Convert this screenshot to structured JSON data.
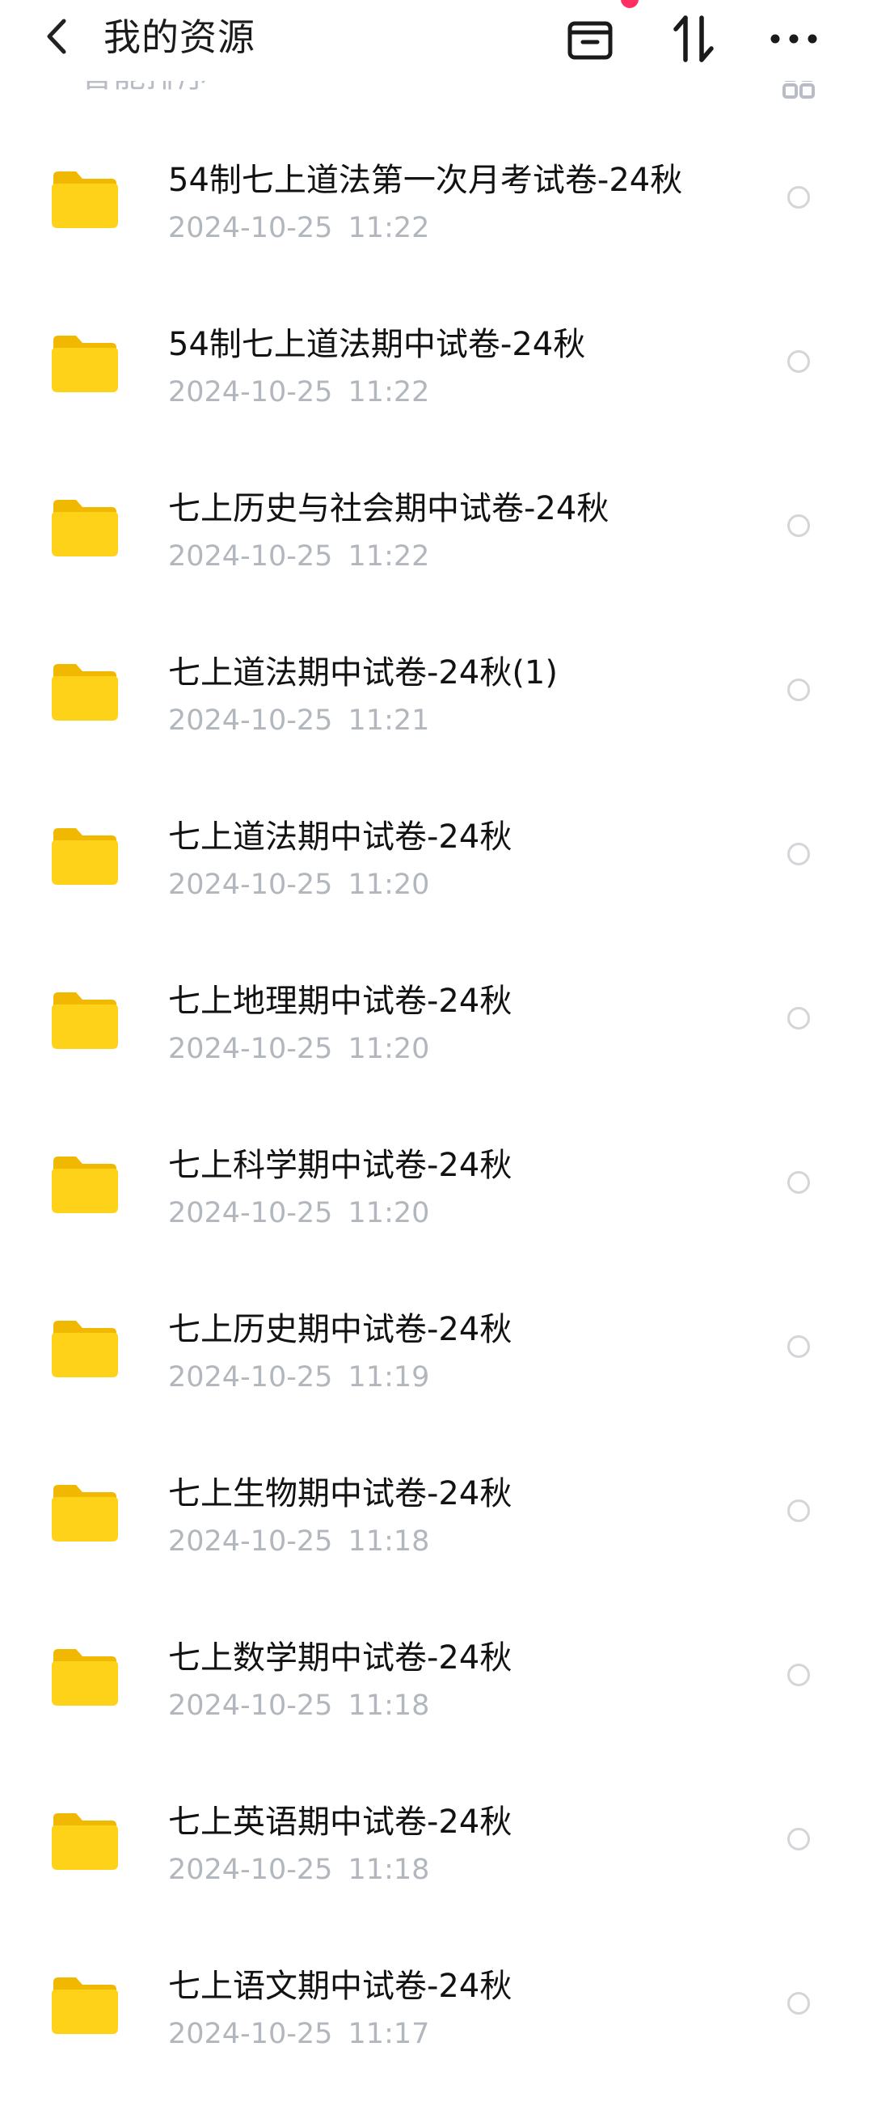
{
  "header": {
    "title": "我的资源",
    "icons": [
      "back-icon",
      "archive-icon",
      "sort-icon",
      "more-icon"
    ],
    "notification_color": "#ff2e63"
  },
  "subbar": {
    "sort_label": "智能排序 ˅",
    "view_icon": "grid-view-icon"
  },
  "folder_color": "#f7c600",
  "files": [
    {
      "name": "54制七上道法第一次月考试卷-24秋",
      "date": "2024-10-25 11:22"
    },
    {
      "name": "54制七上道法期中试卷-24秋",
      "date": "2024-10-25 11:22"
    },
    {
      "name": "七上历史与社会期中试卷-24秋",
      "date": "2024-10-25 11:22"
    },
    {
      "name": "七上道法期中试卷-24秋(1)",
      "date": "2024-10-25 11:21"
    },
    {
      "name": "七上道法期中试卷-24秋",
      "date": "2024-10-25 11:20"
    },
    {
      "name": "七上地理期中试卷-24秋",
      "date": "2024-10-25 11:20"
    },
    {
      "name": "七上科学期中试卷-24秋",
      "date": "2024-10-25 11:20"
    },
    {
      "name": "七上历史期中试卷-24秋",
      "date": "2024-10-25 11:19"
    },
    {
      "name": "七上生物期中试卷-24秋",
      "date": "2024-10-25 11:18"
    },
    {
      "name": "七上数学期中试卷-24秋",
      "date": "2024-10-25 11:18"
    },
    {
      "name": "七上英语期中试卷-24秋",
      "date": "2024-10-25 11:18"
    },
    {
      "name": "七上语文期中试卷-24秋",
      "date": "2024-10-25 11:17"
    }
  ]
}
